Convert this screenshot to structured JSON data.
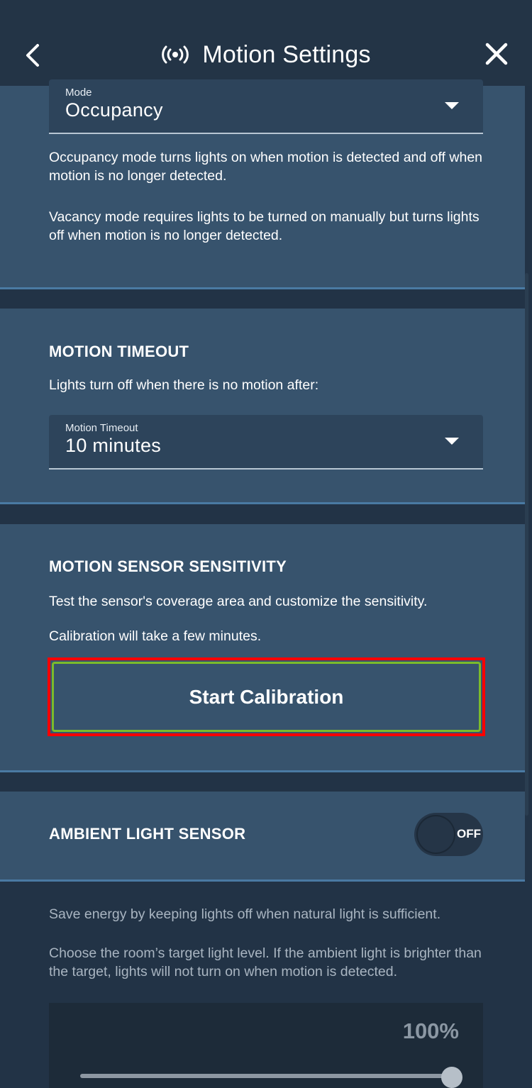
{
  "header": {
    "title": "Motion Settings",
    "icons": {
      "back": "chevron-left-icon",
      "title": "motion-sensor-icon",
      "close": "close-icon"
    }
  },
  "mode": {
    "label": "Mode",
    "value": "Occupancy",
    "occupancy_desc": "Occupancy mode turns lights on when motion is detected and off when motion is no longer detected.",
    "vacancy_desc": "Vacancy mode requires lights to be turned on manually but turns lights off when motion is no longer detected."
  },
  "timeout": {
    "heading": "MOTION TIMEOUT",
    "desc": "Lights turn off when there is no motion after:",
    "label": "Motion Timeout",
    "value": "10 minutes"
  },
  "sensitivity": {
    "heading": "MOTION SENSOR SENSITIVITY",
    "desc": "Test the sensor's coverage area and customize the sensitivity.",
    "note": "Calibration will take a few minutes.",
    "button_label": "Start Calibration"
  },
  "ambient": {
    "heading": "AMBIENT LIGHT SENSOR",
    "toggle_state": "OFF",
    "desc": "Save energy by keeping lights off when natural light is sufficient.",
    "target_desc": "Choose the room’s target light level. If the ambient light is brighter than the target, lights will not turn on when motion is detected.",
    "level_value": "100%",
    "level_fraction": 1.0
  },
  "colors": {
    "header_bg": "#233446",
    "card_bg": "#37536d",
    "accent_border": "#4a7aa3",
    "calibration_border": "#7cbb2b",
    "highlight": "#ff0000"
  }
}
